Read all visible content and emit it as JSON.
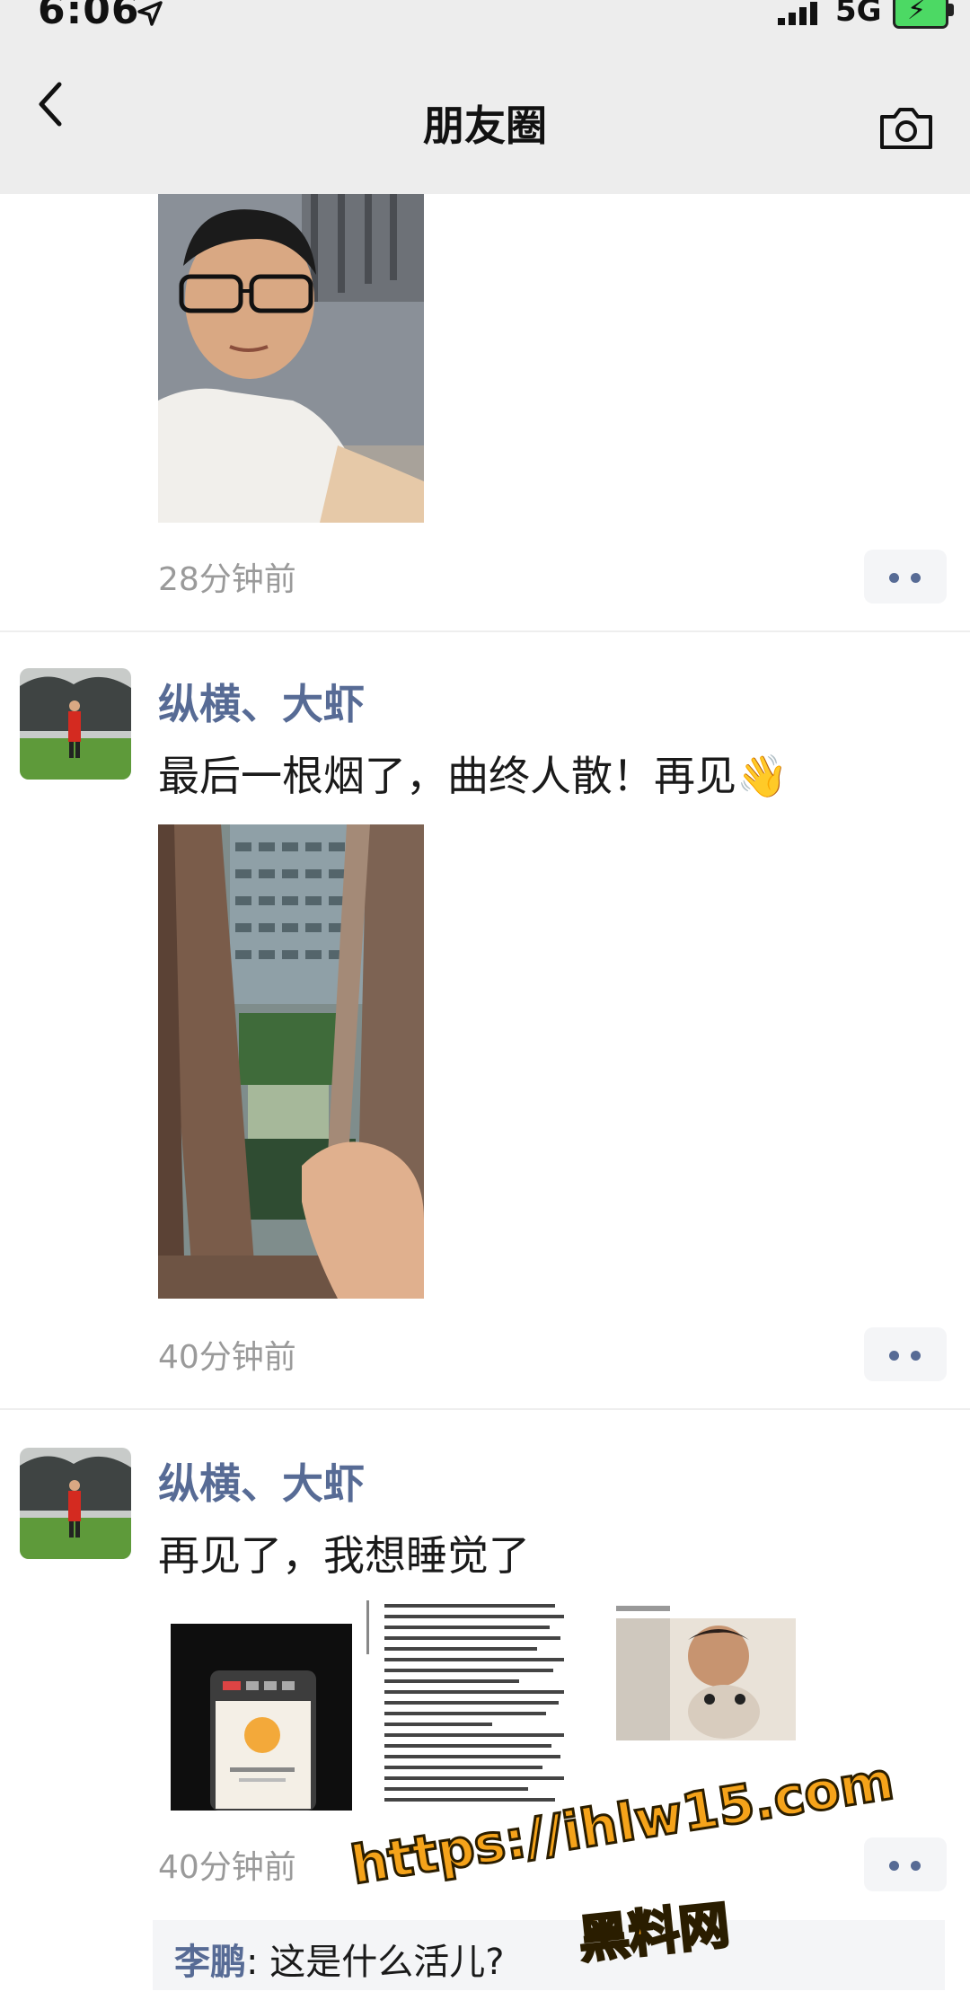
{
  "status_bar": {
    "time": "6:06",
    "network": "5G"
  },
  "nav": {
    "title": "朋友圈"
  },
  "posts": [
    {
      "timestamp": "28分钟前"
    },
    {
      "username": "纵横、大虾",
      "text": "最后一根烟了，曲终人散！再见",
      "emoji": "👋",
      "timestamp": "40分钟前"
    },
    {
      "username": "纵横、大虾",
      "text": "再见了，我想睡觉了",
      "timestamp": "40分钟前"
    }
  ],
  "comment": {
    "user": "李鹏",
    "text": "这是什么活儿?"
  },
  "watermark": {
    "url": "https://ihlw15.com",
    "site": "黑料网"
  },
  "colors": {
    "link": "#576b95",
    "nav_bg": "#ededed",
    "watermark": "#f5a31a"
  }
}
